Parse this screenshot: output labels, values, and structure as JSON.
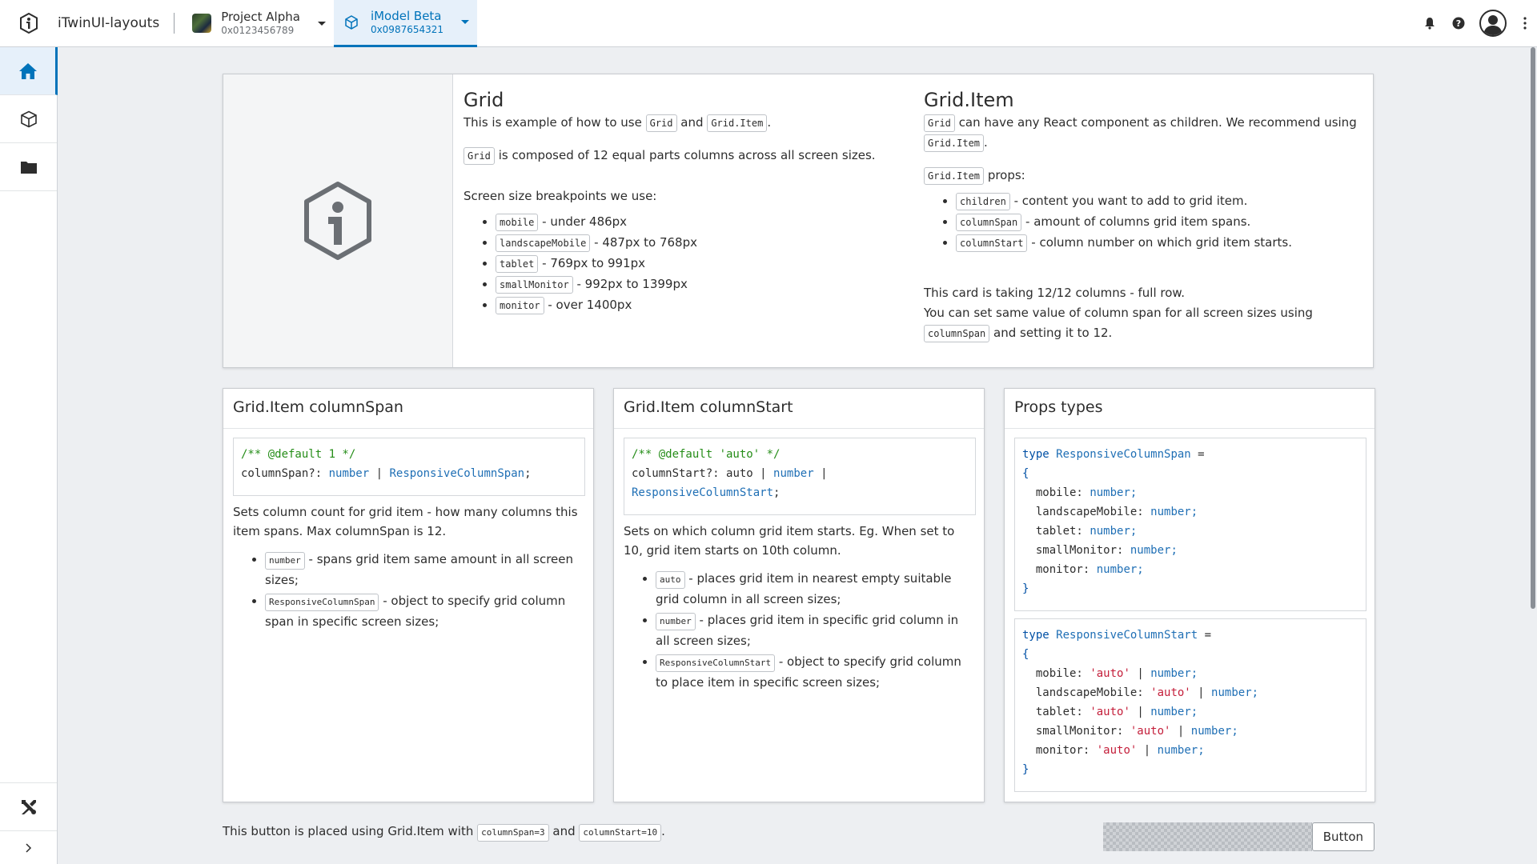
{
  "header": {
    "app_title": "iTwinUI-layouts",
    "project": {
      "name": "Project Alpha",
      "id": "0x0123456789"
    },
    "imodel": {
      "name": "iModel Beta",
      "id": "0x0987654321"
    }
  },
  "colors": {
    "accent": "#0073ba",
    "background": "#edeff2"
  },
  "top_card": {
    "grid": {
      "title": "Grid",
      "intro_a": "This is example of how to use",
      "intro_code1": "Grid",
      "intro_and": "and",
      "intro_code2": "Grid.Item",
      "intro_end": ".",
      "composed_code": "Grid",
      "composed_text": "is composed of 12 equal parts columns across all screen sizes.",
      "breakpoints_label": "Screen size breakpoints we use:",
      "breakpoints": [
        {
          "code": "mobile",
          "text": "- under 486px"
        },
        {
          "code": "landscapeMobile",
          "text": "- 487px to 768px"
        },
        {
          "code": "tablet",
          "text": "- 769px to 991px"
        },
        {
          "code": "smallMonitor",
          "text": "- 992px to 1399px"
        },
        {
          "code": "monitor",
          "text": "- over 1400px"
        }
      ]
    },
    "item": {
      "title": "Grid.Item",
      "children_code": "Grid",
      "children_text": "can have any React component as children. We recommend using",
      "children_code2": "Grid.Item",
      "children_end": ".",
      "props_code": "Grid.Item",
      "props_text": "props:",
      "props": [
        {
          "code": "children",
          "text": "- content you want to add to grid item."
        },
        {
          "code": "columnSpan",
          "text": "- amount of columns grid item spans."
        },
        {
          "code": "columnStart",
          "text": "- column number on which grid item starts."
        }
      ],
      "full_row": "This card is taking 12/12 columns - full row.",
      "same_value_a": "You can set same value of column span for all screen sizes using",
      "same_value_code": "columnSpan",
      "same_value_b": "and",
      "same_value_c": "setting it to 12."
    }
  },
  "span_card": {
    "title": "Grid.Item columnSpan",
    "code_comment": "/** @default 1 */",
    "code_prop": "columnSpan?:",
    "code_t1": "number",
    "code_pipe": "|",
    "code_t2": "ResponsiveColumnSpan",
    "code_semi": ";",
    "desc": "Sets column count for grid item - how many columns this item spans. Max columnSpan is 12.",
    "items": [
      {
        "code": "number",
        "text": "- spans grid item same amount in all screen sizes;"
      },
      {
        "code": "ResponsiveColumnSpan",
        "text": "- object to specify grid column span in specific screen sizes;"
      }
    ]
  },
  "start_card": {
    "title": "Grid.Item columnStart",
    "code_comment": "/** @default 'auto' */",
    "code_prop": "columnStart?:",
    "code_auto": "auto",
    "code_pipe": "|",
    "code_t1": "number",
    "code_pipe2": "|",
    "code_t2": "ResponsiveColumnStart",
    "code_semi": ";",
    "desc": "Sets on which column grid item starts. Eg. When set to 10, grid item starts on 10th column.",
    "items": [
      {
        "code": "auto",
        "text": "- places grid item in nearest empty suitable grid column in all screen sizes;"
      },
      {
        "code": "number",
        "text": "- places grid item in specific grid column in all screen sizes;"
      },
      {
        "code": "ResponsiveColumnStart",
        "text": "- object to specify grid column to place item in specific screen sizes;"
      }
    ]
  },
  "props_card": {
    "title": "Props types",
    "span_type": {
      "kw": "type",
      "name": "ResponsiveColumnSpan",
      "eq": "=",
      "open": "{",
      "fields": [
        {
          "key": "mobile:",
          "val": "number;"
        },
        {
          "key": "landscapeMobile:",
          "val": "number;"
        },
        {
          "key": "tablet:",
          "val": "number;"
        },
        {
          "key": "smallMonitor:",
          "val": "number;"
        },
        {
          "key": "monitor:",
          "val": "number;"
        }
      ],
      "close": "}"
    },
    "start_type": {
      "kw": "type",
      "name": "ResponsiveColumnStart",
      "eq": "=",
      "open": "{",
      "fields": [
        {
          "key": "mobile:",
          "str": "'auto'",
          "pipe": "|",
          "val": "number;"
        },
        {
          "key": "landscapeMobile:",
          "str": "'auto'",
          "pipe": "|",
          "val": "number;"
        },
        {
          "key": "tablet:",
          "str": "'auto'",
          "pipe": "|",
          "val": "number;"
        },
        {
          "key": "smallMonitor:",
          "str": "'auto'",
          "pipe": "|",
          "val": "number;"
        },
        {
          "key": "monitor:",
          "str": "'auto'",
          "pipe": "|",
          "val": "number;"
        }
      ],
      "close": "}"
    }
  },
  "footer": {
    "text_a": "This button is placed using Grid.Item with",
    "code1": "columnSpan=3",
    "and": "and",
    "code2": "columnStart=10",
    "end": ".",
    "button_label": "Button"
  }
}
